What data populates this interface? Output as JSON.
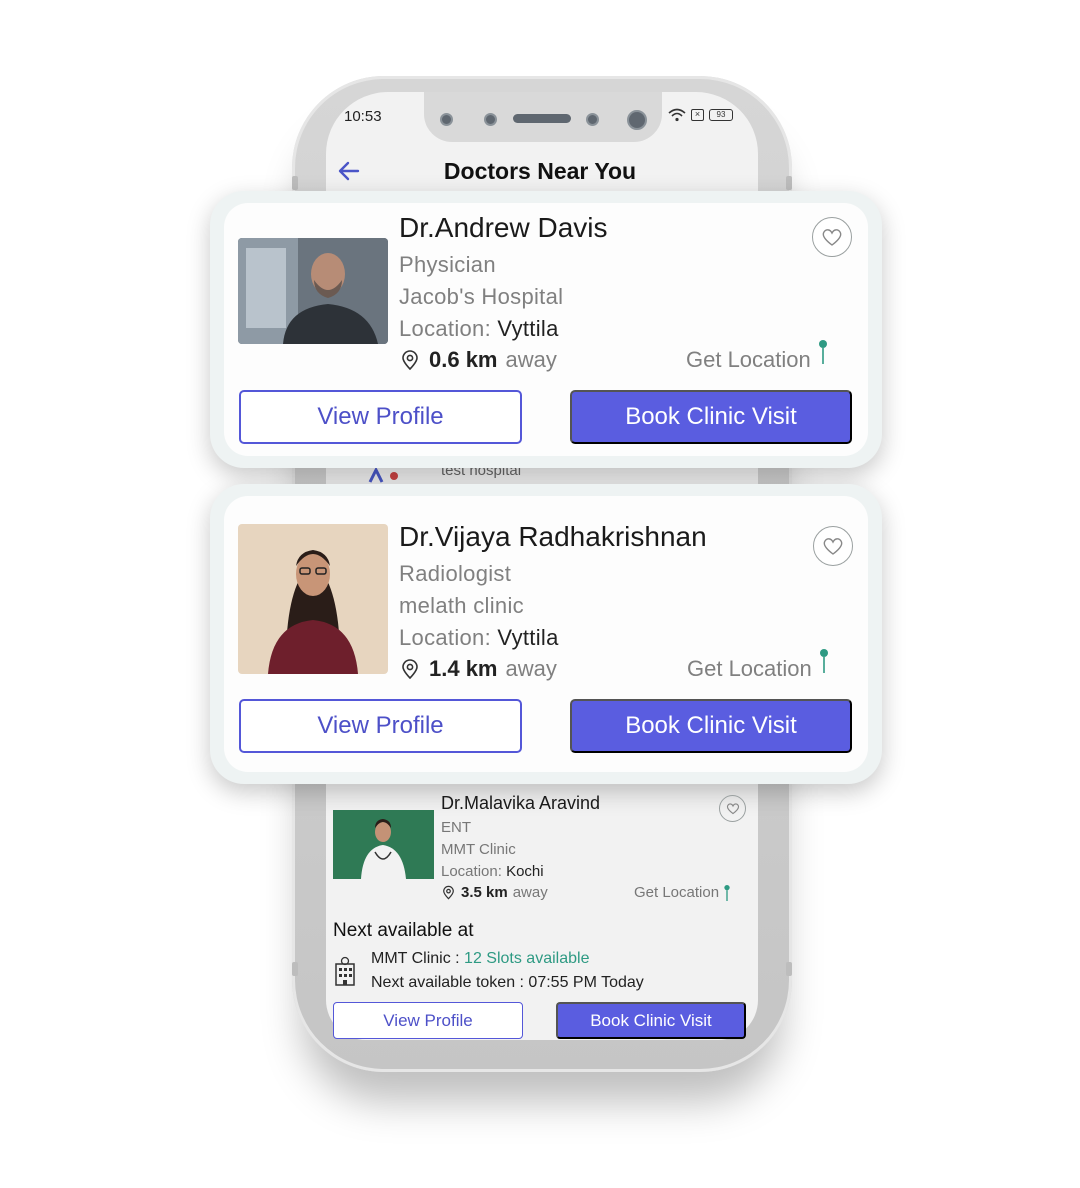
{
  "status_bar": {
    "time": "10:53",
    "battery": "93"
  },
  "header": {
    "title": "Doctors Near You"
  },
  "peek_text": "test hospital",
  "doctors": [
    {
      "name": "Dr.Andrew Davis",
      "specialty": "Physician",
      "hospital": "Jacob's Hospital",
      "location_label": "Location:",
      "location": "Vyttila",
      "distance": "0.6 km",
      "away": "away",
      "get_location": "Get Location",
      "view_profile": "View Profile",
      "book": "Book Clinic Visit"
    },
    {
      "name": "Dr.Vijaya Radhakrishnan",
      "specialty": "Radiologist",
      "hospital": "melath clinic",
      "location_label": "Location:",
      "location": "Vyttila",
      "distance": "1.4 km",
      "away": "away",
      "get_location": "Get Location",
      "view_profile": "View Profile",
      "book": "Book Clinic Visit"
    },
    {
      "name": "Dr.Malavika Aravind",
      "specialty": "ENT",
      "hospital": "MMT Clinic",
      "location_label": "Location:",
      "location": "Kochi",
      "distance": "3.5 km",
      "away": "away",
      "get_location": "Get Location",
      "next_available_title": "Next available at",
      "clinic_name": "MMT Clinic :",
      "slots": "12 Slots available",
      "token_line": "Next available token : 07:55 PM Today",
      "view_profile": "View Profile",
      "book": "Book Clinic Visit"
    }
  ],
  "colors": {
    "accent": "#5a5de0",
    "pin_green": "#2e9a83"
  }
}
